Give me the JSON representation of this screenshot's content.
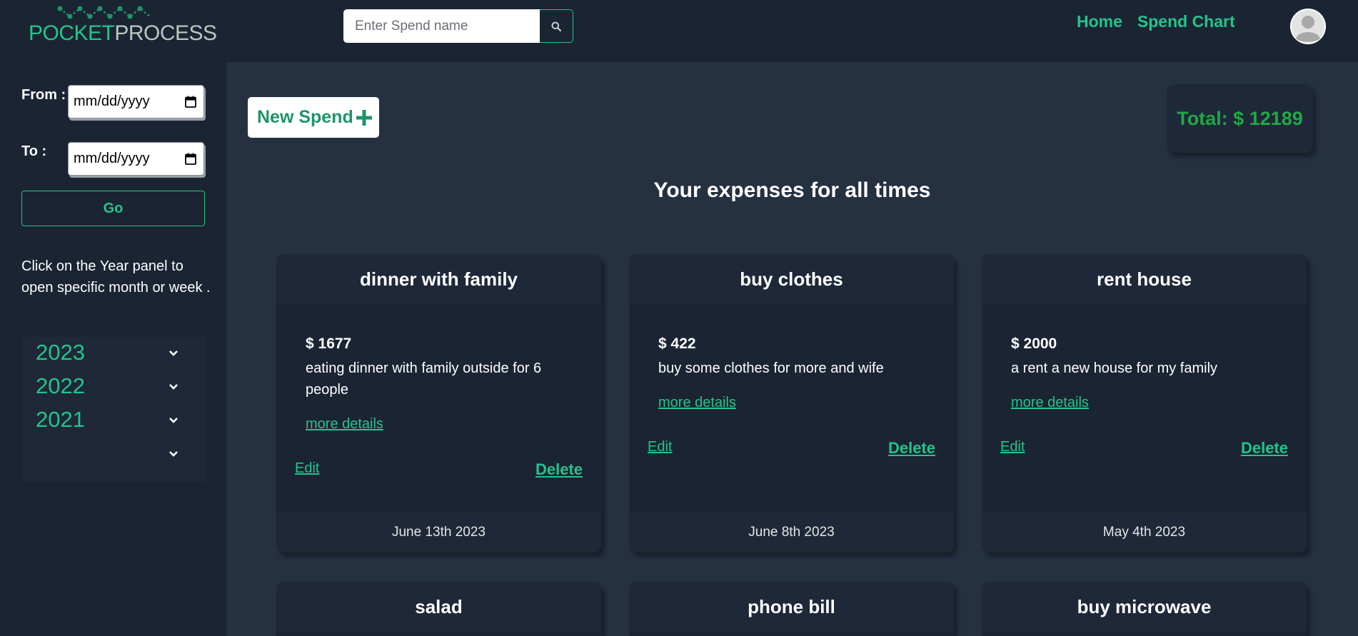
{
  "app": {
    "logo_part1": "POCKET",
    "logo_part2": "PROCESS",
    "brand_color": "#23c48b"
  },
  "search": {
    "placeholder": "Enter Spend name",
    "button_icon": "search-icon"
  },
  "nav": {
    "home_label": "Home",
    "spend_chart_label": "Spend Chart",
    "avatar_icon": "user-avatar-icon"
  },
  "sidebar": {
    "from_label": "From :",
    "to_label": "To :",
    "from_value": "mm/dd/yyyy",
    "to_value": "mm/dd/yyyy",
    "go_label": "Go",
    "help_text": "Click on the Year panel to open specific month or week .",
    "years": [
      "2023",
      "2022",
      "2021",
      ""
    ]
  },
  "main": {
    "new_spend_label": "New Spend",
    "total_label": "Total: $ 12189",
    "heading": "Your expenses for all times",
    "edit_label": "Edit",
    "delete_label": "Delete",
    "more_label": "more details"
  },
  "cards": [
    {
      "title": "dinner with family",
      "amount": "$ 1677",
      "description": "eating dinner with family outside for 6 people",
      "date": "June 13th 2023"
    },
    {
      "title": "buy clothes",
      "amount": "$ 422",
      "description": "buy some clothes for more and wife",
      "date": "June 8th 2023"
    },
    {
      "title": "rent house",
      "amount": "$ 2000",
      "description": "a rent a new house for my family",
      "date": "May 4th 2023"
    },
    {
      "title": "salad"
    },
    {
      "title": "phone bill"
    },
    {
      "title": "buy microwave"
    }
  ]
}
